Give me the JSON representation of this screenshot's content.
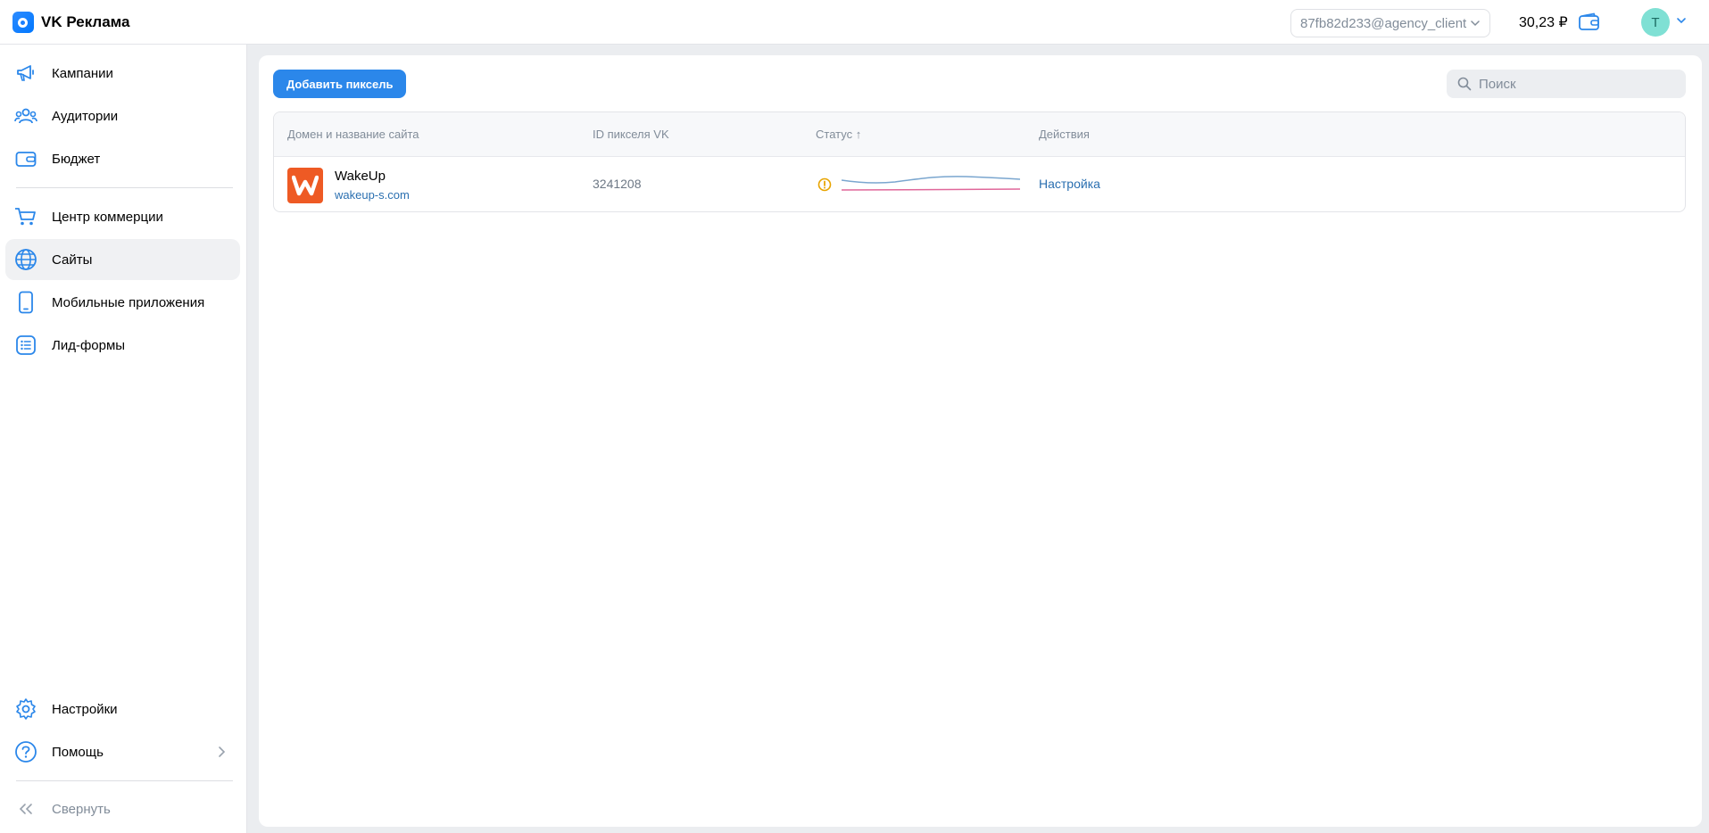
{
  "app": {
    "title": "VK Реклама"
  },
  "header": {
    "account": "87fb82d233@agency_client",
    "balance": "30,23 ₽",
    "avatar_letter": "T"
  },
  "sidebar": {
    "items": [
      {
        "label": "Кампании",
        "icon": "megaphone-icon"
      },
      {
        "label": "Аудитории",
        "icon": "users-icon"
      },
      {
        "label": "Бюджет",
        "icon": "wallet-icon"
      },
      {
        "label": "Центр коммерции",
        "icon": "cart-icon"
      },
      {
        "label": "Сайты",
        "icon": "globe-icon",
        "active": true
      },
      {
        "label": "Мобильные приложения",
        "icon": "phone-icon"
      },
      {
        "label": "Лид-формы",
        "icon": "list-icon"
      }
    ],
    "bottom": [
      {
        "label": "Настройки",
        "icon": "gear-icon"
      },
      {
        "label": "Помощь",
        "icon": "help-icon"
      }
    ],
    "collapse_label": "Свернуть"
  },
  "main": {
    "add_button": "Добавить пиксель",
    "search_placeholder": "Поиск",
    "table": {
      "headers": [
        "Домен и название сайта",
        "ID пикселя VK",
        "Статус ↑",
        "Действия"
      ],
      "rows": [
        {
          "logo_letter": "W",
          "name": "WakeUp",
          "domain": "wakeup-s.com",
          "pixel_id": "3241208",
          "action": "Настройка"
        }
      ]
    }
  },
  "colors": {
    "accent": "#2b87ea",
    "link": "#2a6fb0",
    "warning": "#e8a400",
    "site_logo": "#ee5a24"
  }
}
